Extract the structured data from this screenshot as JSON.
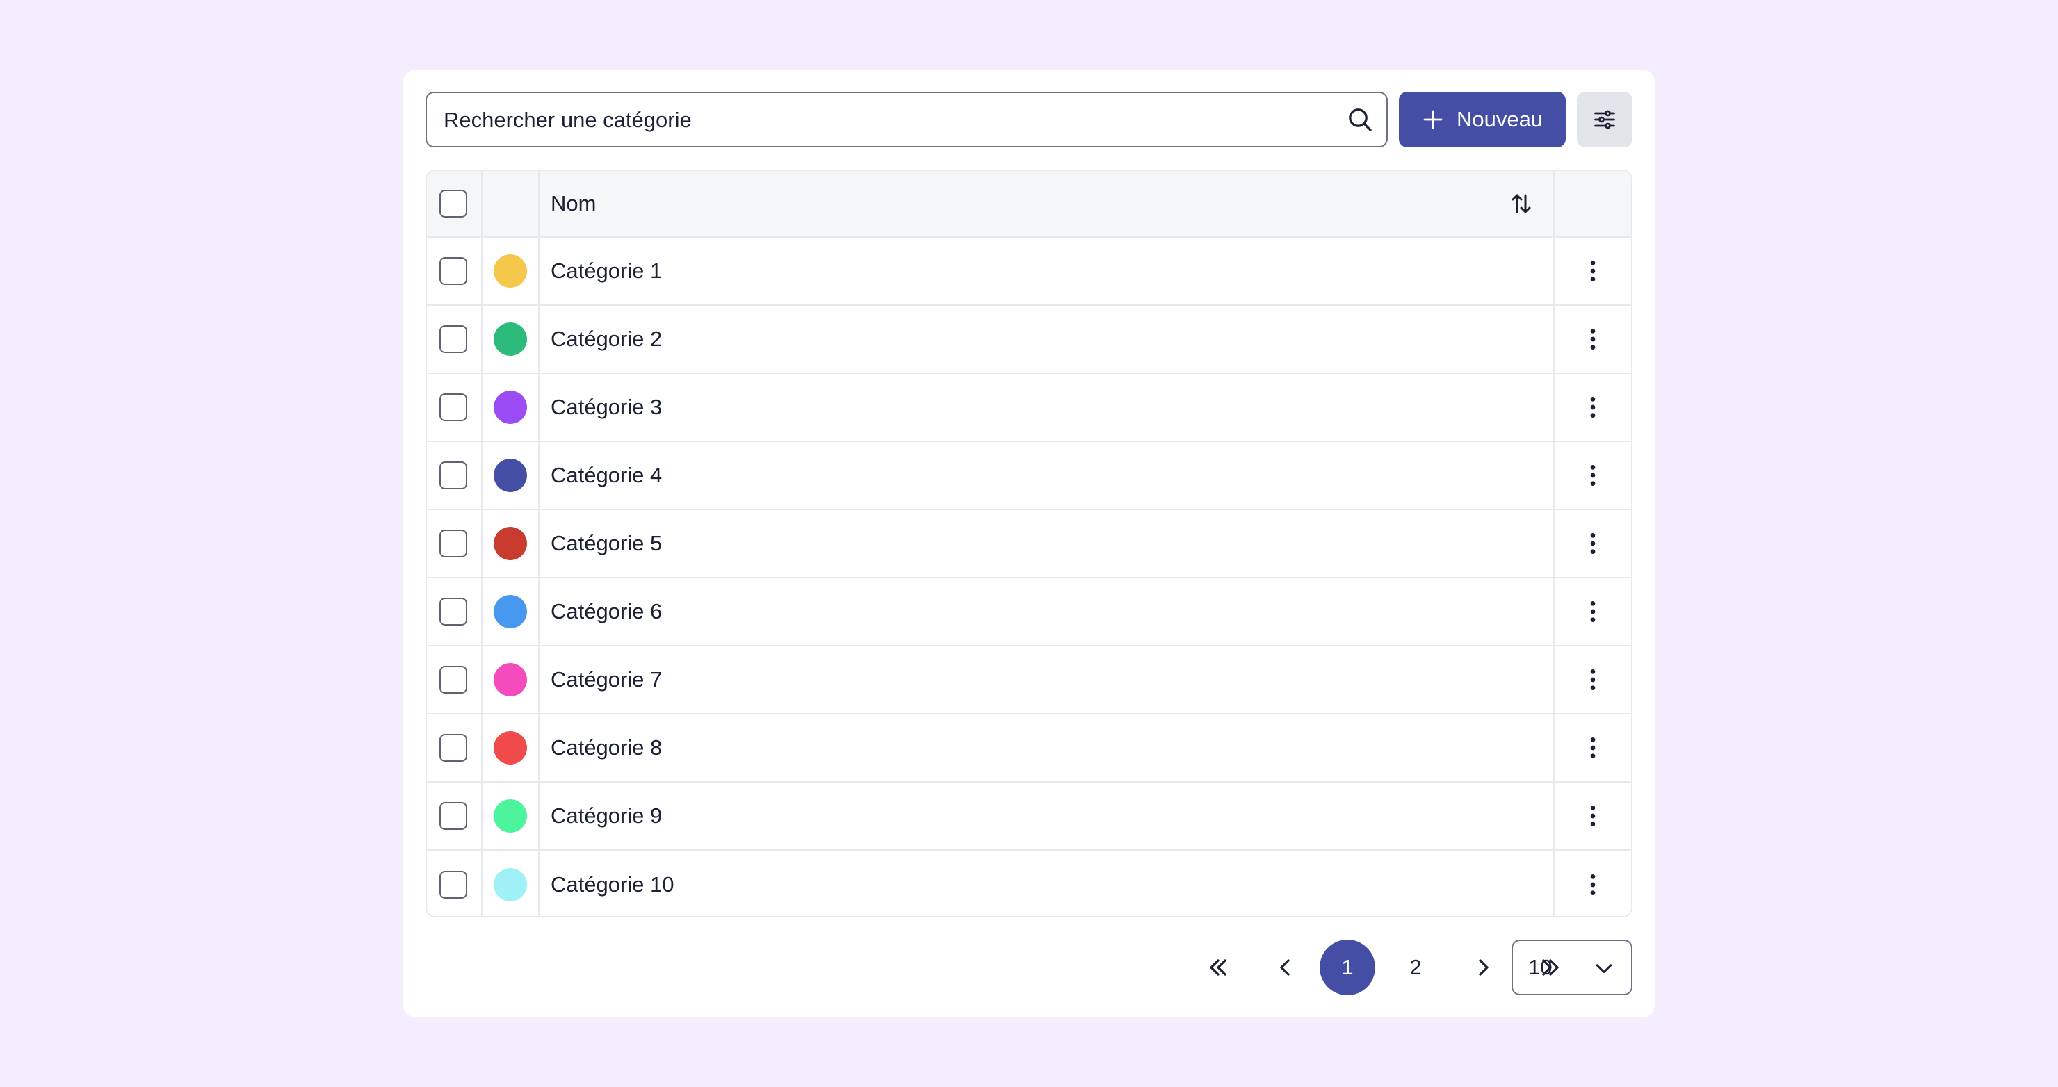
{
  "search": {
    "placeholder": "Rechercher une catégorie",
    "value": ""
  },
  "toolbar": {
    "new_label": "Nouveau"
  },
  "table": {
    "header": {
      "name": "Nom"
    },
    "rows": [
      {
        "name": "Catégorie 1",
        "color": "#f5c84c"
      },
      {
        "name": "Catégorie 2",
        "color": "#2cbb7a"
      },
      {
        "name": "Catégorie 3",
        "color": "#9b4cf5"
      },
      {
        "name": "Catégorie 4",
        "color": "#454ea5"
      },
      {
        "name": "Catégorie 5",
        "color": "#c93a2f"
      },
      {
        "name": "Catégorie 6",
        "color": "#4898ef"
      },
      {
        "name": "Catégorie 7",
        "color": "#f54cbd"
      },
      {
        "name": "Catégorie 8",
        "color": "#f04a4a"
      },
      {
        "name": "Catégorie 9",
        "color": "#4cf59b"
      },
      {
        "name": "Catégorie 10",
        "color": "#a0f0f8"
      }
    ]
  },
  "pagination": {
    "pages": [
      "1",
      "2"
    ],
    "current": "1",
    "page_size": "10"
  },
  "colors": {
    "accent": "#454ea5",
    "background": "#f4edfd"
  }
}
